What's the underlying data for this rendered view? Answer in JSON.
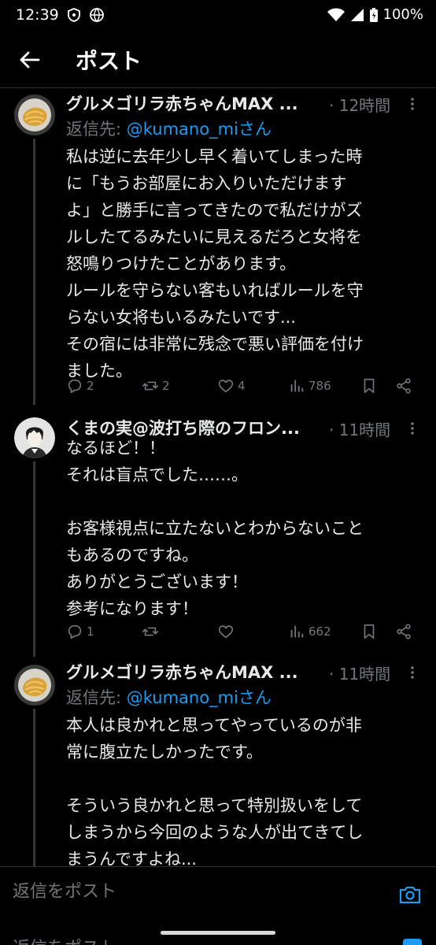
{
  "status_bar": {
    "time": "12:39",
    "battery": "100%",
    "icons": [
      "shield-icon",
      "globe-icon",
      "wifi-icon",
      "signal-icon",
      "battery-icon"
    ]
  },
  "header": {
    "title": "ポスト",
    "back_icon": "arrow-left-icon"
  },
  "tweets": [
    {
      "name": "グルメゴリラ赤ちゃんMAX ...",
      "time": "· 12時間",
      "reply_prefix": "返信先: ",
      "reply_handle": "@kumano_mi",
      "reply_suffix": "さん",
      "lines": [
        "私は逆に去年少し早く着いてしまった時",
        "に「もうお部屋にお入りいただけます",
        "よ」と勝手に言ってきたので私だけがズ",
        "ルしたてるみたいに見えるだろと女将を",
        "怒鳴りつけたことがあります。",
        "ルールを守らない客もいればルールを守",
        "らない女将もいるみたいです...",
        "その宿には非常に残念で悪い評価を付け",
        "ました。"
      ],
      "replies": "2",
      "reposts": "2",
      "likes": "4",
      "views": "786"
    },
    {
      "name": "くまの実@波打ち際のフロン...",
      "time": "· 11時間",
      "lines": [
        "なるほど！！",
        "それは盲点でした……。",
        "",
        "お客様視点に立たないとわからないこと",
        "もあるのですね。",
        "ありがとうございます！",
        "参考になります！"
      ],
      "replies": "1",
      "reposts": "",
      "likes": "",
      "views": "662"
    },
    {
      "name": "グルメゴリラ赤ちゃんMAX ...",
      "time": "· 11時間",
      "reply_prefix": "返信先: ",
      "reply_handle": "@kumano_mi",
      "reply_suffix": "さん",
      "lines": [
        "本人は良かれと思ってやっているのが非",
        "常に腹立たしかったです。",
        "",
        "そういう良かれと思って特別扱いをして",
        "しまうから今回のような人が出てきてし",
        "まうんですよね..."
      ]
    }
  ],
  "composer": {
    "placeholder": "返信をポスト",
    "below_text": "返信をポスト"
  },
  "colors": {
    "accent": "#1d9bf0",
    "muted": "#71767b",
    "text": "#e7e9ea",
    "divider": "#2f3336"
  }
}
